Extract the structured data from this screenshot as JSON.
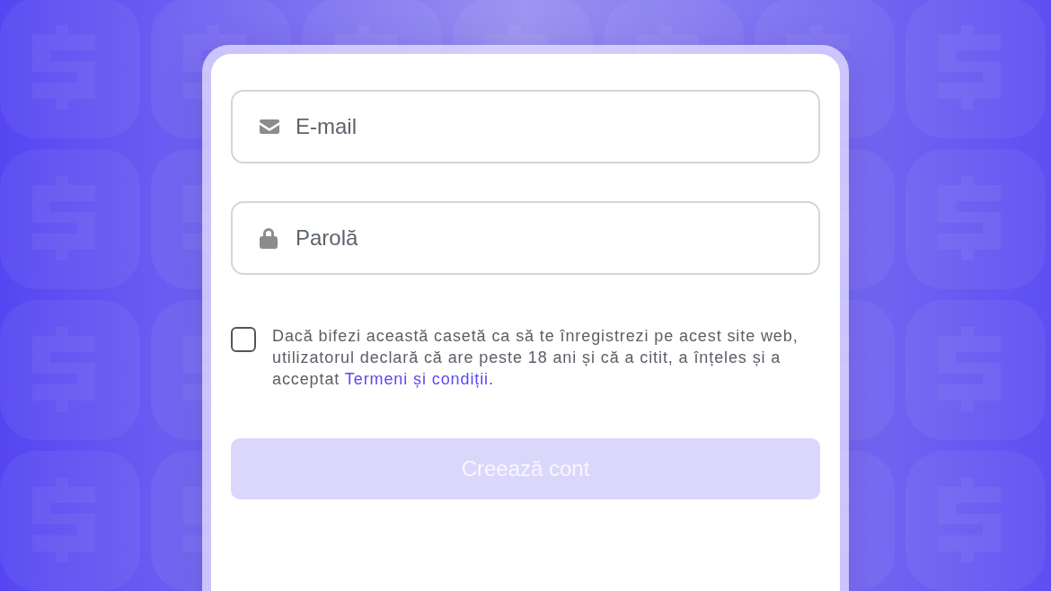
{
  "fields": [
    {
      "kind": "email",
      "placeholder": "E-mail"
    },
    {
      "kind": "password",
      "placeholder": "Parolă"
    }
  ],
  "consent": {
    "checked": false,
    "text_before": "Dacă bifezi această casetă ca să te înregistrezi pe acest site web, utilizatorul declară că are peste 18 ani și că a citit, a înțeles și a acceptat ",
    "link": "Termeni și condiții",
    "text_after": "."
  },
  "submit": {
    "label": "Creează cont",
    "disabled": true
  }
}
